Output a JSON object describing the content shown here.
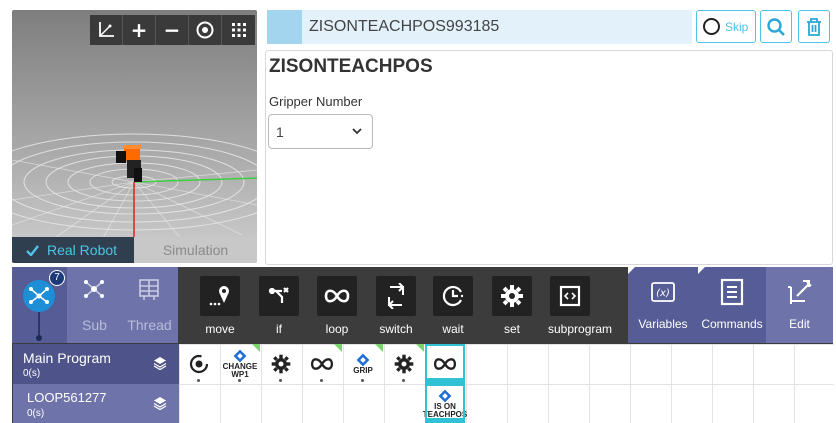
{
  "viewport": {
    "toolbar_icons": [
      "axes-icon",
      "zoom-in-icon",
      "zoom-out-icon",
      "eye-icon",
      "grid-icon"
    ],
    "mode_real": "Real Robot",
    "mode_sim": "Simulation"
  },
  "command_header": {
    "name": "ZISONTEACHPOS993185",
    "skip_label": "Skip"
  },
  "properties": {
    "title": "ZISONTEACHPOS",
    "field_label": "Gripper Number",
    "field_value": "1"
  },
  "program_tabs": {
    "badge": "7",
    "sub_label": "Sub",
    "thread_label": "Thread"
  },
  "commands": [
    {
      "label": "move",
      "icon": "move-icon"
    },
    {
      "label": "if",
      "icon": "if-icon"
    },
    {
      "label": "loop",
      "icon": "loop-icon"
    },
    {
      "label": "switch",
      "icon": "switch-icon"
    },
    {
      "label": "wait",
      "icon": "wait-icon"
    },
    {
      "label": "set",
      "icon": "set-icon"
    },
    {
      "label": "subprogram",
      "icon": "subprogram-icon"
    }
  ],
  "side_buttons": {
    "variables": "Variables",
    "commands": "Commands",
    "edit": "Edit"
  },
  "program_rows": [
    {
      "name": "Main Program",
      "time": "0(s)"
    },
    {
      "name": "LOOP561277",
      "time": "0(s)"
    }
  ],
  "main_blocks": [
    {
      "type": "start",
      "label": ""
    },
    {
      "type": "diamond",
      "label": "CHANGE\nWP1"
    },
    {
      "type": "gear",
      "label": ""
    },
    {
      "type": "loop",
      "label": ""
    },
    {
      "type": "diamond",
      "label": "GRIP"
    },
    {
      "type": "gear",
      "label": ""
    },
    {
      "type": "loop",
      "label": ""
    }
  ],
  "loop_blocks": [
    {
      "type": "diamond",
      "label": "IS ON\nTEACHPOS"
    }
  ],
  "colors": {
    "accent": "#4fc3e6",
    "toolbar_purple": "#6e74a9",
    "dark_panel": "#3c3c3c",
    "selected": "#30c2d4"
  }
}
